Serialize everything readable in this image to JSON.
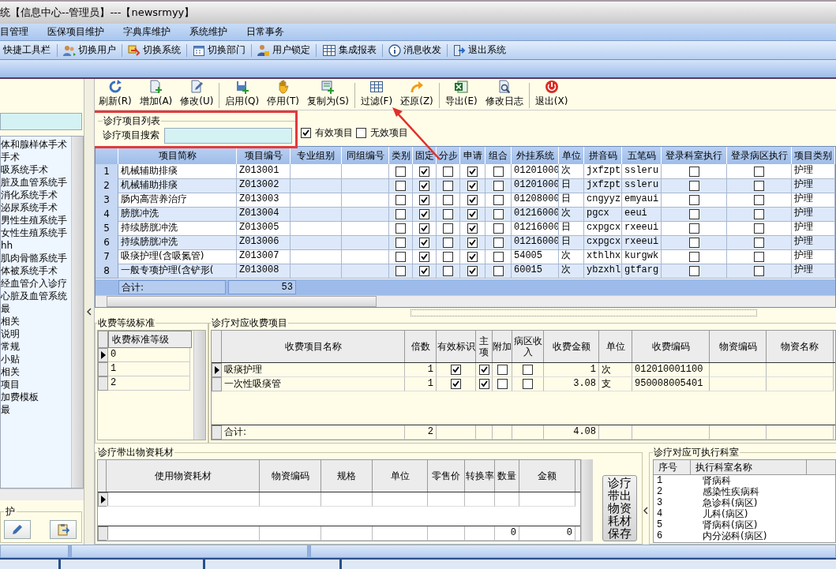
{
  "window": {
    "title": "统【信息中心--管理员】---【newsrmyy】"
  },
  "menu": [
    "目管理",
    "医保项目维护",
    "字典库维护",
    "系统维护",
    "日常事务"
  ],
  "quick_toolbar": {
    "label": "快捷工具栏",
    "items": [
      "切换用户",
      "切换系统",
      "切换部门",
      "用户锁定",
      "集成报表",
      "消息收发",
      "退出系统"
    ]
  },
  "sidebar": {
    "tree_items": [
      "体和腺样体手术",
      "手术",
      "吸系统手术",
      "脏及血管系统手",
      "消化系统手术",
      "泌尿系统手术",
      "男性生殖系统手",
      "女性生殖系统手",
      "hh",
      "肌肉骨骼系统手",
      "体被系统手术",
      "经血管介入诊疗",
      "心脏及血管系统",
      "最",
      "相关",
      "说明",
      "常规",
      "小贴",
      "相关",
      "项目",
      "加费模板",
      "最"
    ],
    "group_title": "护"
  },
  "toolbar": [
    {
      "label": "刷新(R)",
      "separator_after": false
    },
    {
      "label": "增加(A)",
      "separator_after": false
    },
    {
      "label": "修改(U)",
      "separator_after": true
    },
    {
      "label": "启用(Q)",
      "separator_after": false
    },
    {
      "label": "停用(T)",
      "separator_after": false
    },
    {
      "label": "复制为(S)",
      "separator_after": true
    },
    {
      "label": "过滤(F)",
      "separator_after": false
    },
    {
      "label": "还原(Z)",
      "separator_after": true
    },
    {
      "label": "导出(E)",
      "separator_after": false
    },
    {
      "label": "修改日志",
      "separator_after": true
    },
    {
      "label": "退出(X)",
      "separator_after": false
    }
  ],
  "search_panel": {
    "title": "诊疗项目列表",
    "label": "诊疗项目搜索",
    "filters": [
      {
        "label": "有效项目",
        "checked": true
      },
      {
        "label": "无效项目",
        "checked": false
      }
    ]
  },
  "items_table": {
    "columns": [
      {
        "label": "项目简称",
        "kind": "text"
      },
      {
        "label": "项目编号",
        "kind": "text"
      },
      {
        "label": "专业组别",
        "kind": "text"
      },
      {
        "label": "同组编号",
        "kind": "text"
      },
      {
        "label": "类别",
        "kind": "check"
      },
      {
        "label": "固定",
        "kind": "check"
      },
      {
        "label": "分步",
        "kind": "check"
      },
      {
        "label": "申请",
        "kind": "check"
      },
      {
        "label": "组合",
        "kind": "check"
      },
      {
        "label": "外挂系统",
        "kind": "text"
      },
      {
        "label": "单位",
        "kind": "text"
      },
      {
        "label": "拼音码",
        "kind": "text"
      },
      {
        "label": "五笔码",
        "kind": "text"
      },
      {
        "label": "登录科室执行",
        "kind": "check"
      },
      {
        "label": "登录病区执行",
        "kind": "check"
      },
      {
        "label": "项目类别",
        "kind": "text"
      }
    ],
    "rows": [
      {
        "number": "1",
        "cells": [
          "机械辅助排痰",
          "Z013001",
          null,
          null,
          false,
          true,
          false,
          true,
          false,
          "01201000",
          "次",
          "jxfzpt",
          "ssleru",
          false,
          false,
          "护理"
        ]
      },
      {
        "number": "2",
        "cells": [
          "机械辅助排痰",
          "Z013002",
          null,
          null,
          false,
          true,
          false,
          true,
          false,
          "01201000",
          "日",
          "jxfzpt",
          "ssleru",
          false,
          false,
          "护理"
        ]
      },
      {
        "number": "3",
        "cells": [
          "肠内高营养治疗",
          "Z013003",
          null,
          null,
          false,
          true,
          false,
          true,
          false,
          "01208000",
          "日",
          "cngyyz",
          "emyaui",
          false,
          false,
          "护理"
        ]
      },
      {
        "number": "4",
        "cells": [
          "膀胱冲洗",
          "Z013004",
          null,
          null,
          false,
          true,
          false,
          true,
          false,
          "01216000",
          "次",
          "pgcx",
          "eeui",
          false,
          false,
          "护理"
        ]
      },
      {
        "number": "5",
        "cells": [
          "持续膀胱冲洗",
          "Z013005",
          null,
          null,
          false,
          true,
          false,
          true,
          false,
          "01216000",
          "日",
          "cxpgcx",
          "rxeeui",
          false,
          false,
          "护理"
        ]
      },
      {
        "number": "6",
        "cells": [
          "持续膀胱冲洗",
          "Z013006",
          null,
          null,
          false,
          true,
          false,
          true,
          false,
          "01216000",
          "日",
          "cxpgcx",
          "rxeeui",
          false,
          false,
          "护理"
        ]
      },
      {
        "number": "7",
        "cells": [
          "吸痰护理(含吸氮管)",
          "Z013007",
          null,
          null,
          false,
          true,
          false,
          true,
          false,
          "54005",
          "次",
          "xthlhx",
          "kurgwk",
          false,
          false,
          "护理"
        ]
      },
      {
        "number": "8",
        "cells": [
          "一般专项护理(含铲形(",
          "Z013008",
          null,
          null,
          false,
          true,
          false,
          true,
          false,
          "60015",
          "次",
          "ybzxhl",
          "gtfarg",
          false,
          false,
          "护理"
        ]
      }
    ],
    "total_label": "合计:",
    "total_value": "53"
  },
  "fee_levels": {
    "title": "收费等级标准",
    "column": "收费标准等级",
    "rows": [
      {
        "value": "0",
        "selected": true
      },
      {
        "value": "1",
        "selected": false
      },
      {
        "value": "2",
        "selected": false
      }
    ]
  },
  "charge_items": {
    "title": "诊疗对应收费项目",
    "columns": [
      {
        "label": "收费项目名称",
        "kind": "text"
      },
      {
        "label": "倍数",
        "kind": "num"
      },
      {
        "label": "有效标识",
        "kind": "check"
      },
      {
        "label": "主项",
        "kind": "check"
      },
      {
        "label": "附加",
        "kind": "check"
      },
      {
        "label": "病区收入",
        "kind": "check"
      },
      {
        "label": "收费金额",
        "kind": "num"
      },
      {
        "label": "单位",
        "kind": "text"
      },
      {
        "label": "收费编码",
        "kind": "text"
      },
      {
        "label": "物资编码",
        "kind": "text"
      },
      {
        "label": "物资名称",
        "kind": "text"
      }
    ],
    "rows": [
      {
        "selected": true,
        "cells": [
          "吸痰护理",
          "1",
          true,
          true,
          false,
          false,
          "1",
          "次",
          "012010001100",
          null,
          null
        ]
      },
      {
        "selected": false,
        "cells": [
          "一次性吸痰管",
          "1",
          true,
          true,
          false,
          false,
          "3.08",
          "支",
          "950008005401",
          null,
          null
        ]
      }
    ],
    "total_label": "合计:",
    "total_count": "2",
    "total_amount": "4.08"
  },
  "materials": {
    "title": "诊疗带出物资耗材",
    "columns": [
      "使用物资耗材",
      "物资编码",
      "规格",
      "单位",
      "零售价",
      "转换率",
      "数量",
      "金额"
    ],
    "total_quantity": "0",
    "total_amount": "0",
    "save_button": "诊疗带出物资耗材保存"
  },
  "departments": {
    "title": "诊疗对应可执行科室",
    "columns": [
      "序号",
      "执行科室名称"
    ],
    "rows": [
      {
        "number": "1",
        "name": "肾病科"
      },
      {
        "number": "2",
        "name": "感染性疾病科"
      },
      {
        "number": "3",
        "name": "急诊科(病区)"
      },
      {
        "number": "4",
        "name": "儿科(病区)"
      },
      {
        "number": "5",
        "name": "肾病科(病区)"
      },
      {
        "number": "6",
        "name": "内分泌科(病区)"
      }
    ]
  }
}
